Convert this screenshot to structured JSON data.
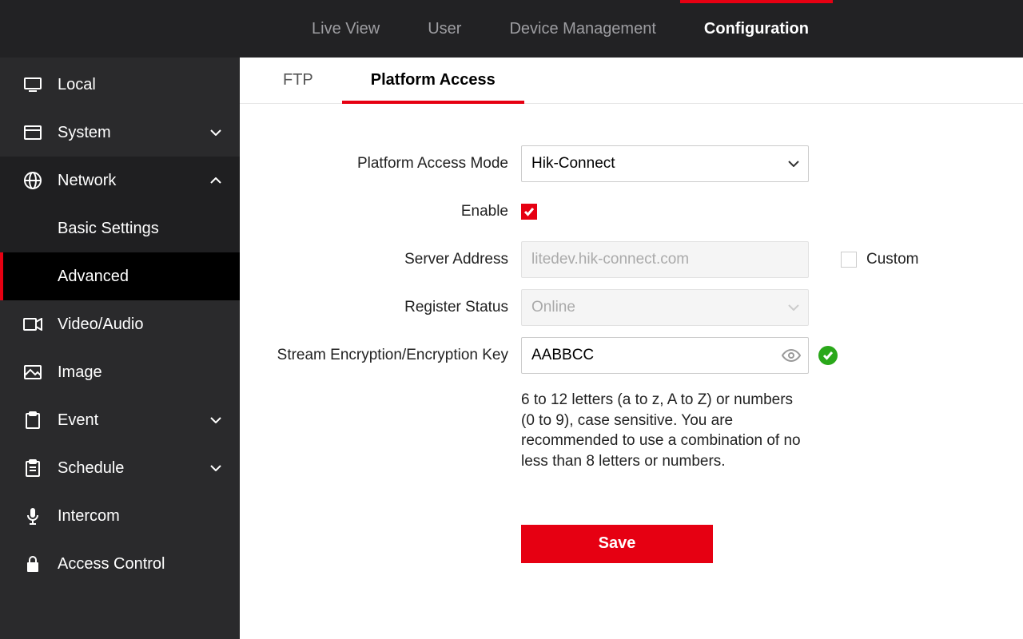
{
  "header": {
    "tabs": [
      {
        "label": "Live View",
        "active": false
      },
      {
        "label": "User",
        "active": false
      },
      {
        "label": "Device Management",
        "active": false
      },
      {
        "label": "Configuration",
        "active": true
      }
    ]
  },
  "sidebar": [
    {
      "icon": "monitor-icon",
      "label": "Local",
      "expandable": false
    },
    {
      "icon": "window-icon",
      "label": "System",
      "expandable": true,
      "expanded": false
    },
    {
      "icon": "globe-icon",
      "label": "Network",
      "expandable": true,
      "expanded": true,
      "children": [
        {
          "label": "Basic Settings",
          "active": false
        },
        {
          "label": "Advanced",
          "active": true
        }
      ]
    },
    {
      "icon": "video-icon",
      "label": "Video/Audio",
      "expandable": false
    },
    {
      "icon": "image-icon",
      "label": "Image",
      "expandable": false
    },
    {
      "icon": "clipboard-icon",
      "label": "Event",
      "expandable": true,
      "expanded": false
    },
    {
      "icon": "clipboard-list-icon",
      "label": "Schedule",
      "expandable": true,
      "expanded": false
    },
    {
      "icon": "mic-icon",
      "label": "Intercom",
      "expandable": false
    },
    {
      "icon": "lock-icon",
      "label": "Access Control",
      "expandable": false
    }
  ],
  "subtabs": [
    {
      "label": "FTP",
      "active": false
    },
    {
      "label": "Platform Access",
      "active": true
    }
  ],
  "form": {
    "platform_access_mode_label": "Platform Access Mode",
    "platform_access_mode_value": "Hik-Connect",
    "enable_label": "Enable",
    "enable_checked": true,
    "server_address_label": "Server Address",
    "server_address_value": "litedev.hik-connect.com",
    "custom_label": "Custom",
    "custom_checked": false,
    "register_status_label": "Register Status",
    "register_status_value": "Online",
    "encryption_label": "Stream Encryption/Encryption Key",
    "encryption_value": "AABBCC",
    "encryption_valid": true,
    "hint": "6 to 12 letters (a to z, A to Z) or numbers (0 to 9), case sensitive. You are recommended to use a combination of no less than 8 letters or numbers.",
    "save_label": "Save"
  }
}
